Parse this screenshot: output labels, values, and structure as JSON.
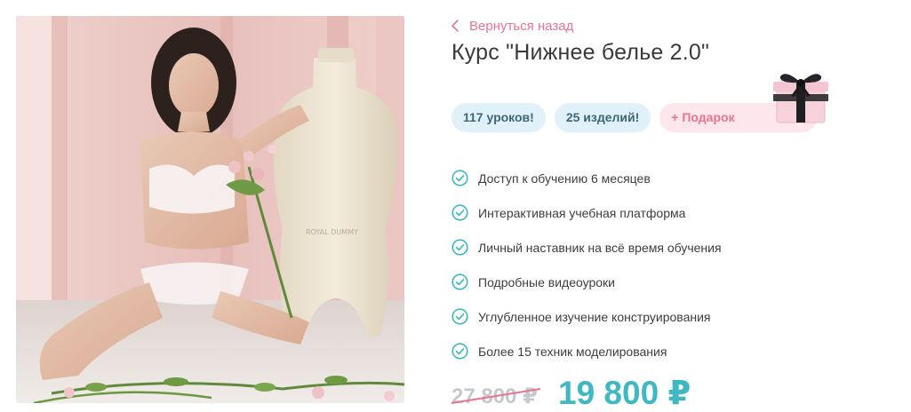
{
  "nav": {
    "back_label": "Вернуться назад"
  },
  "course": {
    "title": "Курс \"Нижнее белье 2.0\""
  },
  "badges": [
    {
      "label": "117 уроков!",
      "kind": "blue"
    },
    {
      "label": "25 изделий!",
      "kind": "blue"
    },
    {
      "label": "+ Подарок",
      "kind": "pink"
    }
  ],
  "features": [
    "Доступ к обучению 6 месяцев",
    "Интерактивная учебная платформа",
    "Личный наставник на всё время обучения",
    "Подробные видеоуроки",
    "Углубленное изучение конструирования",
    "Более 15 техник моделирования"
  ],
  "price": {
    "old": "27 800 ₽",
    "new": "19 800 ₽"
  },
  "colors": {
    "accent_pink": "#e8758f",
    "accent_teal": "#3fb8c3",
    "badge_blue_bg": "#e1f1fa",
    "badge_pink_bg": "#fde6ec",
    "old_price": "#c3c9cd"
  },
  "icons": {
    "back": "chevron-left-icon",
    "feature": "check-circle-icon",
    "gift": "gift-box-icon"
  }
}
